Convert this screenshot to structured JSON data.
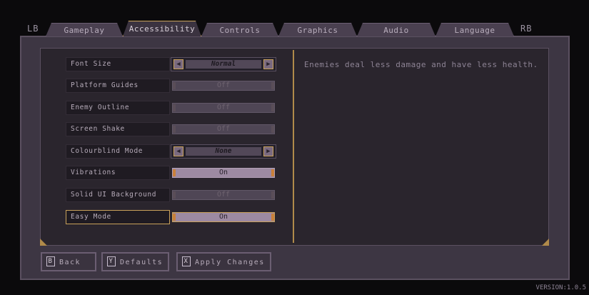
{
  "bumpers": {
    "left": "LB",
    "right": "RB"
  },
  "tabs": [
    {
      "label": "Gameplay"
    },
    {
      "label": "Accessibility",
      "active": true
    },
    {
      "label": "Controls"
    },
    {
      "label": "Graphics"
    },
    {
      "label": "Audio"
    },
    {
      "label": "Language"
    }
  ],
  "settings": [
    {
      "label": "Font Size",
      "type": "selector",
      "value": "Normal"
    },
    {
      "label": "Platform Guides",
      "type": "toggle",
      "value": "Off"
    },
    {
      "label": "Enemy Outline",
      "type": "toggle",
      "value": "Off"
    },
    {
      "label": "Screen Shake",
      "type": "toggle",
      "value": "Off"
    },
    {
      "label": "Colourblind Mode",
      "type": "selector",
      "value": "None"
    },
    {
      "label": "Vibrations",
      "type": "toggle",
      "value": "On"
    },
    {
      "label": "Solid UI Background",
      "type": "toggle",
      "value": "Off"
    },
    {
      "label": "Easy Mode",
      "type": "toggle",
      "value": "On",
      "selected": true
    }
  ],
  "description": "Enemies deal less damage and have less health.",
  "buttons": {
    "back": {
      "key": "B",
      "label": "Back"
    },
    "defaults": {
      "key": "Y",
      "label": "Defaults"
    },
    "apply": {
      "key": "X",
      "label": "Apply Changes"
    }
  },
  "version": "VERSION:1.0.5",
  "colors": {
    "accent": "#c9a15a",
    "toggle_on": "#9d8aa2",
    "cap_on": "#c9803a"
  }
}
